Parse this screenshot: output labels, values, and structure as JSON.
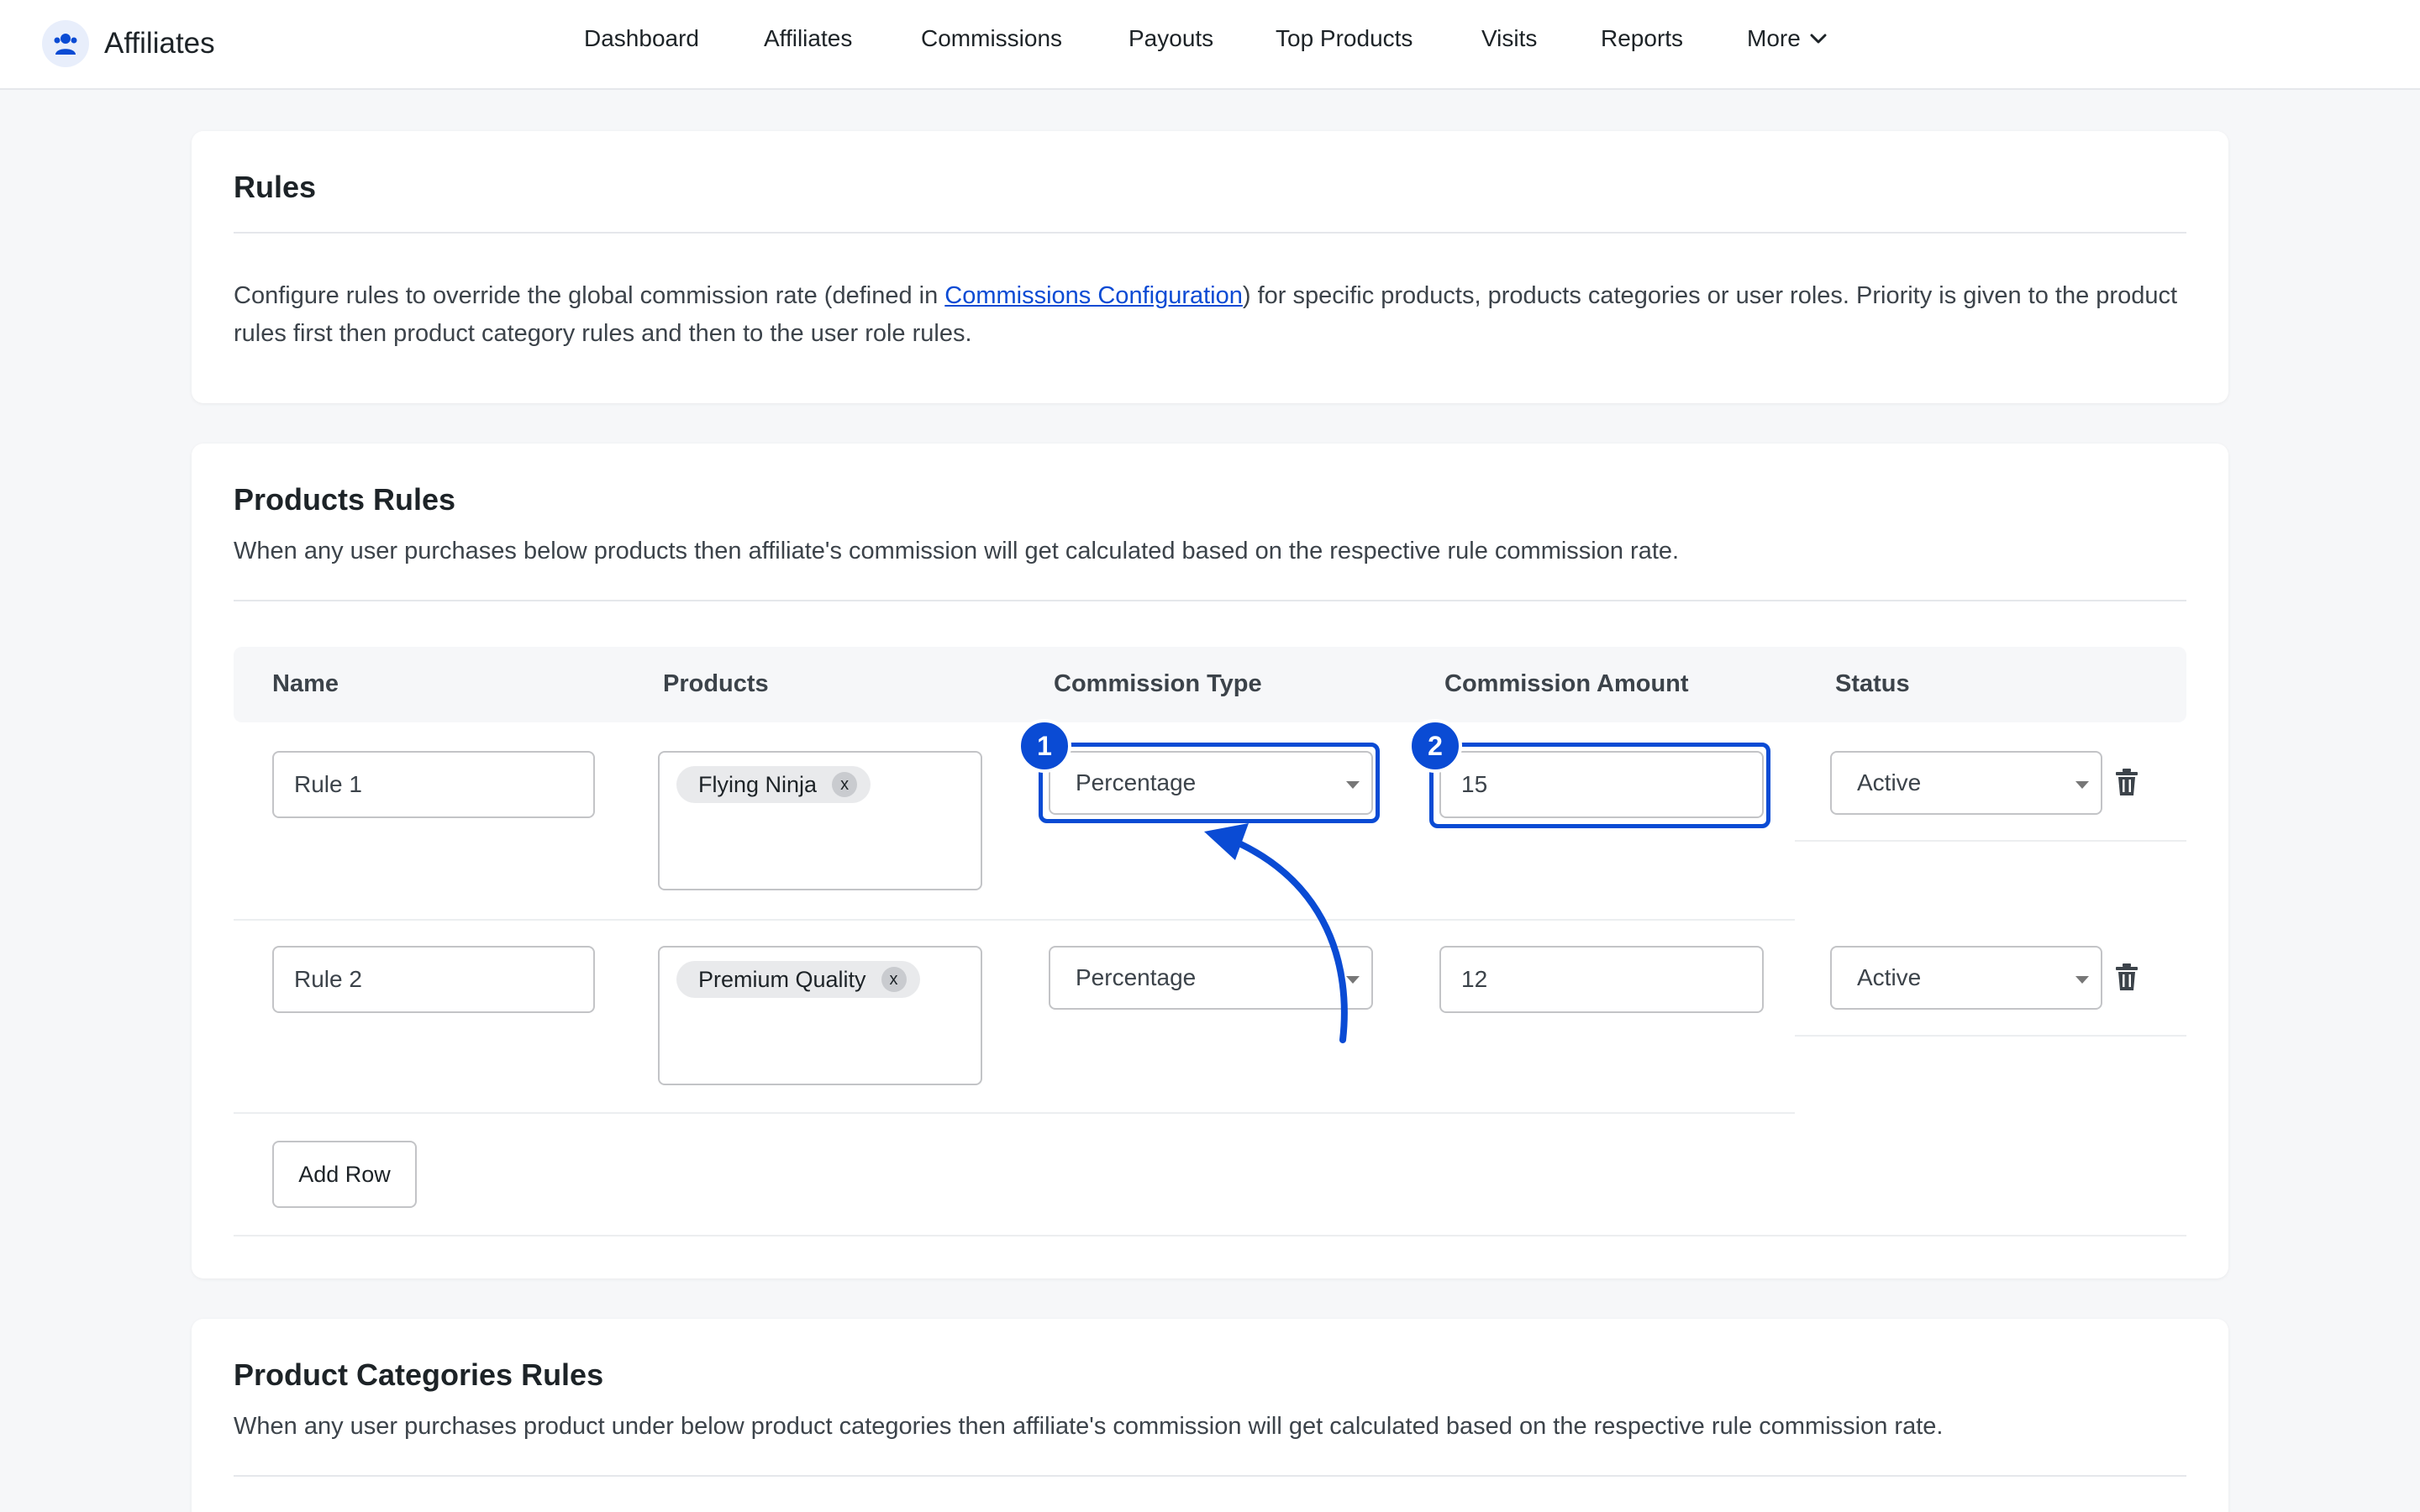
{
  "header": {
    "brand": "Affiliates",
    "nav": [
      {
        "label": "Dashboard"
      },
      {
        "label": "Affiliates"
      },
      {
        "label": "Commissions"
      },
      {
        "label": "Payouts"
      },
      {
        "label": "Top Products"
      },
      {
        "label": "Visits"
      },
      {
        "label": "Reports"
      },
      {
        "label": "More"
      }
    ]
  },
  "rules_card": {
    "title": "Rules",
    "description_before": "Configure rules to override the global commission rate (defined in ",
    "description_link": "Commissions Configuration",
    "description_after": ") for specific products, products categories or user roles. Priority is given to the product rules first then product category rules and then to the user role rules."
  },
  "products_card": {
    "title": "Products Rules",
    "description": "When any user purchases below products then affiliate's commission will get calculated based on the respective rule commission rate.",
    "columns": [
      "Name",
      "Products",
      "Commission Type",
      "Commission Amount",
      "Status"
    ],
    "rows": [
      {
        "name": "Rule 1",
        "product": "Flying Ninja",
        "type": "Percentage",
        "amount": "15",
        "status": "Active"
      },
      {
        "name": "Rule 2",
        "product": "Premium Quality",
        "type": "Percentage",
        "amount": "12",
        "status": "Active"
      }
    ],
    "add_row_label": "Add Row"
  },
  "categories_card": {
    "title": "Product Categories Rules",
    "description": "When any user purchases product under below product categories then affiliate's commission will get calculated based on the respective rule commission rate."
  },
  "annotations": {
    "badge_1": "1",
    "badge_2": "2",
    "accent_color": "#0a4bd4"
  },
  "tag_remove_glyph": "x"
}
